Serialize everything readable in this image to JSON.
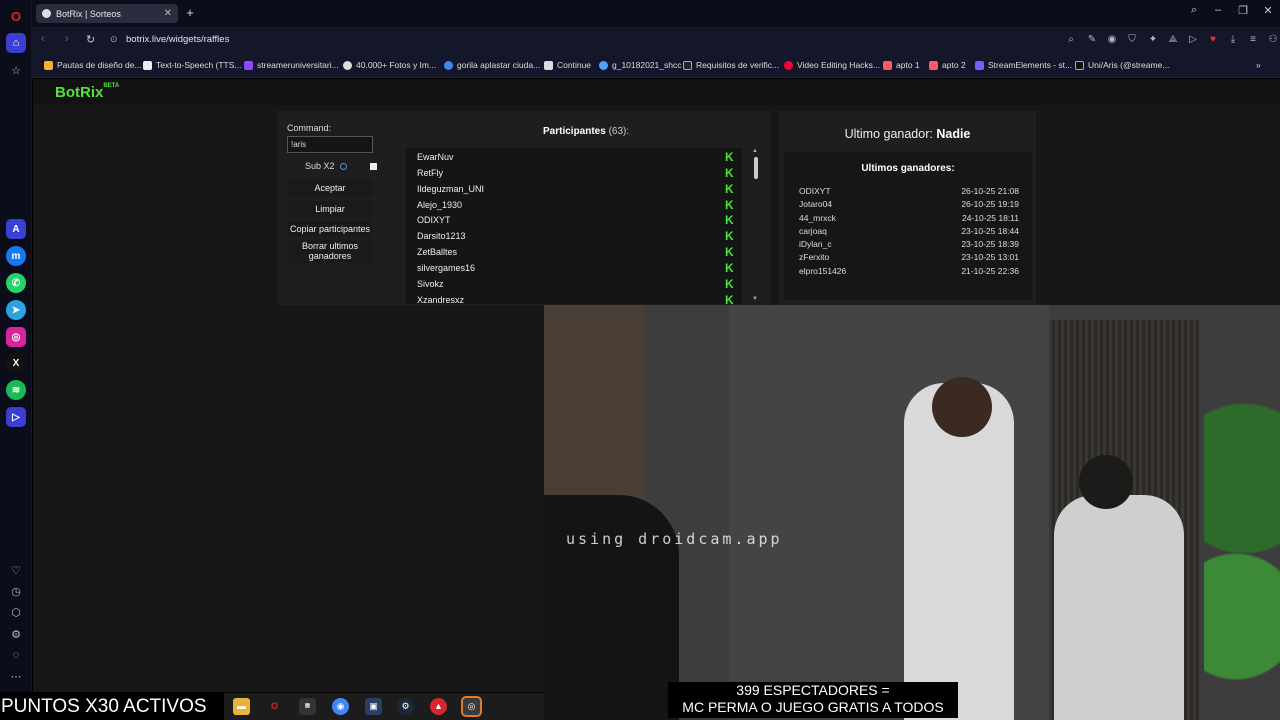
{
  "browser": {
    "tab_title": "BotRix | Sorteos",
    "url": "botrix.live/widgets/raffles",
    "bookmarks": [
      "Pautas de diseño de...",
      "Text-to-Speech (TTS...",
      "streameruniversitari...",
      "40.000+ Fotos y Im...",
      "gorila aplastar ciuda...",
      "Continue",
      "g_10182021_shcc",
      "Requisitos de verific...",
      "Video Editing Hacks...",
      "apto 1",
      "apto 2",
      "StreamElements - st...",
      "Uni/Aris (@streame..."
    ]
  },
  "logo": {
    "text": "BotRix",
    "badge": "BETA"
  },
  "raffle": {
    "command_label": "Command:",
    "command_value": "!aris",
    "sub_label": "Sub X2",
    "accept": "Aceptar",
    "clear": "Limpiar",
    "copy": "Copiar participantes",
    "delete_winners": "Borrar ultimos ganadores",
    "participants_title": "Participantes",
    "participants_count": "(63):",
    "participants": [
      "EwarNuv",
      "RetFly",
      "Ildeguzman_UNI",
      "Alejo_1930",
      "ODIXYT",
      "Darsito1213",
      "ZetBalltes",
      "silvergames16",
      "Sivokz",
      "Xzandresxz"
    ]
  },
  "winner": {
    "last_label": "Ultimo ganador:",
    "last_name": "Nadie",
    "recent_title": "Ultimos ganadores:",
    "recent": [
      {
        "name": "ODIXYT",
        "date": "26-10-25 21:08"
      },
      {
        "name": "Jotaro04",
        "date": "26-10-25 19:19"
      },
      {
        "name": "44_mrxck",
        "date": "24-10-25 18:11"
      },
      {
        "name": "carjoaq",
        "date": "23-10-25 18:44"
      },
      {
        "name": "iDylan_c",
        "date": "23-10-25 18:39"
      },
      {
        "name": "zFerxito",
        "date": "23-10-25 13:01"
      },
      {
        "name": "elpro151426",
        "date": "21-10-25 22:36"
      }
    ]
  },
  "webcam": {
    "watermark": "using droidcam.app"
  },
  "overlay": {
    "ticker": "PUNTOS X30 ACTIVOS",
    "viewers_line1": "399 ESPECTADORES =",
    "viewers_line2": "MC PERMA O JUEGO GRATIS A TODOS"
  },
  "colors": {
    "accent_green": "#55e040",
    "kick_green": "#43e53b"
  }
}
